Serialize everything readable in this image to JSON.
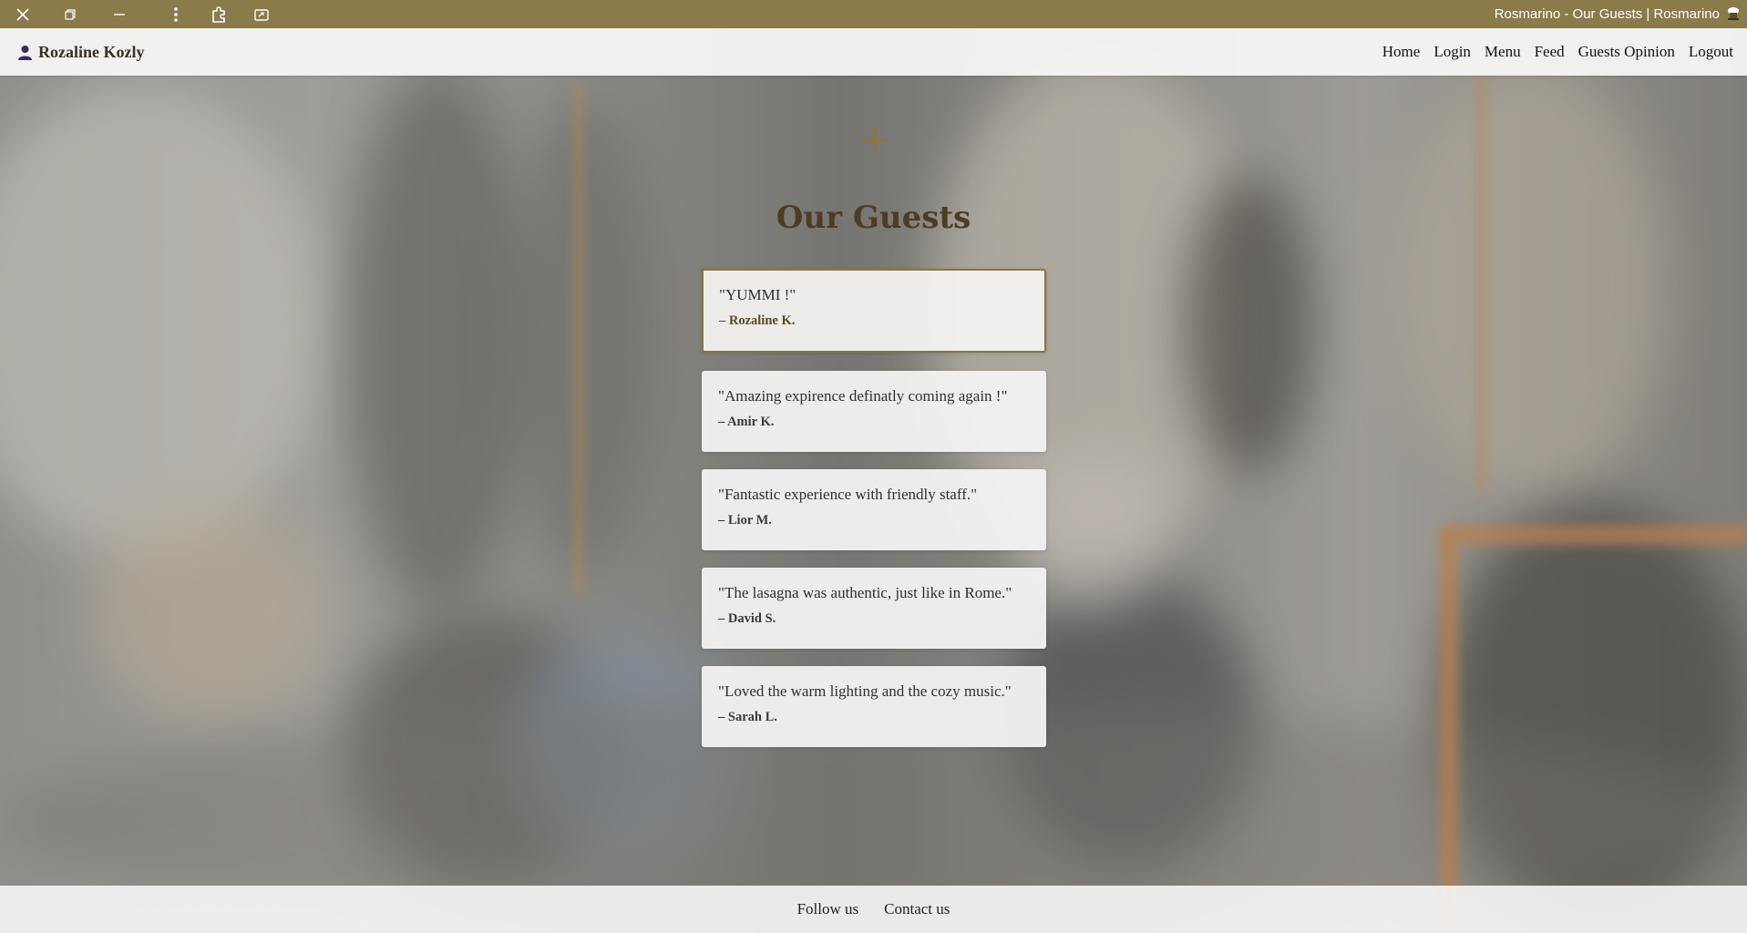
{
  "window": {
    "title": "Rosmarino - Our Guests | Rosmarino",
    "controls": [
      "close-icon",
      "restore-icon",
      "minimize-icon",
      "more-icon",
      "extensions-icon",
      "share-icon"
    ],
    "titlebar_color": "#8b7a4a"
  },
  "navbar": {
    "user_icon": "user-icon",
    "user_name": "Rozaline Kozly",
    "links": [
      "Home",
      "Login",
      "Menu",
      "Feed",
      "Guests Opinion",
      "Logout"
    ]
  },
  "main": {
    "decoration_icon": "cross-icon",
    "title": "Our Guests",
    "reviews": [
      {
        "quote": "\"YUMMI !\"",
        "author": "– Rozaline K."
      },
      {
        "quote": "\"Amazing expirence definatly coming again !\"",
        "author": "– Amir K."
      },
      {
        "quote": "\"Fantastic experience with friendly staff.\"",
        "author": "– Lior M."
      },
      {
        "quote": "\"The lasagna was authentic, just like in Rome.\"",
        "author": "– David S."
      },
      {
        "quote": "\"Loved the warm lighting and the cozy music.\"",
        "author": "– Sarah L."
      }
    ],
    "accent_color": "#8b7640",
    "title_color": "#4d3c25"
  },
  "footer": {
    "links": [
      "Follow us",
      "Contact us"
    ]
  }
}
